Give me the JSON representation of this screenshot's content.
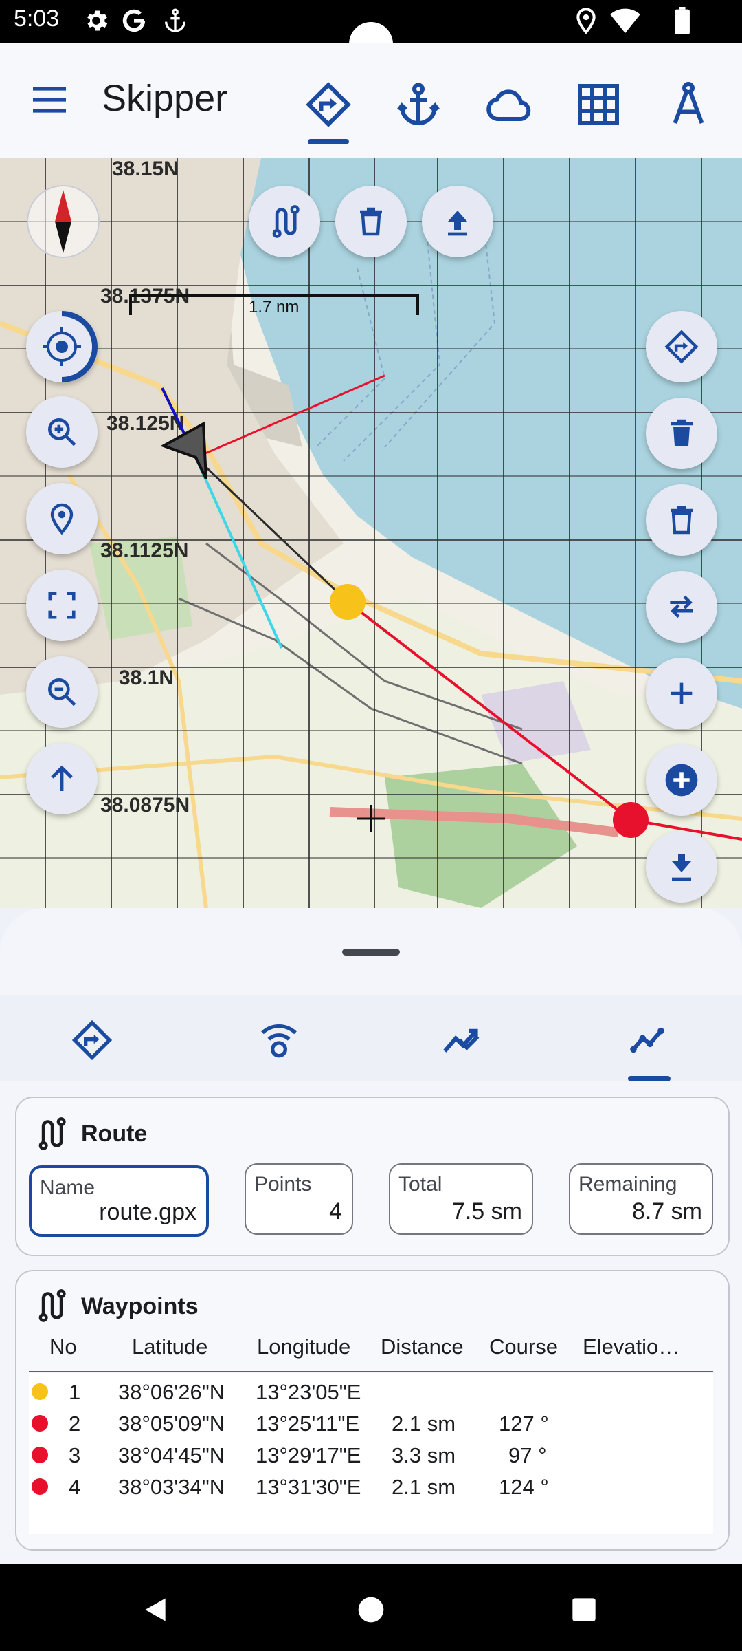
{
  "status_bar": {
    "time": "5:03",
    "icons": [
      "settings-icon",
      "google-icon",
      "anchor-icon",
      "location-icon",
      "wifi-icon",
      "battery-icon"
    ]
  },
  "app": {
    "title": "Skipper",
    "tabs": [
      {
        "icon": "route-icon",
        "active": true
      },
      {
        "icon": "anchor-icon",
        "active": false
      },
      {
        "icon": "cloud-icon",
        "active": false
      },
      {
        "icon": "grid-icon",
        "active": false
      },
      {
        "icon": "compass-divider-icon",
        "active": false
      }
    ]
  },
  "map": {
    "lat_labels": [
      "38.15N",
      "38.1375N",
      "38.125N",
      "38.1125N",
      "38.1N",
      "38.0875N"
    ],
    "scale_label": "1.7 nm",
    "top_buttons": [
      "route-icon",
      "delete-icon",
      "upload-icon"
    ],
    "left_buttons": [
      "locate-icon",
      "zoom-in-icon",
      "pin-icon",
      "fit-screen-icon",
      "zoom-out-icon",
      "north-up-icon"
    ],
    "right_buttons": [
      "route-icon",
      "delete-filled-icon",
      "delete-icon",
      "swap-icon",
      "add-icon",
      "add-circle-icon",
      "download-icon"
    ]
  },
  "bottom_tabs": [
    {
      "icon": "route-icon",
      "active": false
    },
    {
      "icon": "signal-icon",
      "active": false
    },
    {
      "icon": "trend-icon",
      "active": false
    },
    {
      "icon": "chart-line-icon",
      "active": true
    }
  ],
  "route": {
    "title": "Route",
    "name_label": "Name",
    "name_value": "route.gpx",
    "points_label": "Points",
    "points_value": "4",
    "total_label": "Total",
    "total_value": "7.5 sm",
    "remaining_label": "Remaining",
    "remaining_value": "8.7 sm"
  },
  "waypoints": {
    "title": "Waypoints",
    "columns": [
      "No",
      "Latitude",
      "Longitude",
      "Distance",
      "Course",
      "Elevatio…"
    ],
    "rows": [
      {
        "no": "1",
        "lat": "38°06'26\"N",
        "lon": "13°23'05\"E",
        "dist": "",
        "course": "",
        "color": "#f7c21a"
      },
      {
        "no": "2",
        "lat": "38°05'09\"N",
        "lon": "13°25'11\"E",
        "dist": "2.1 sm",
        "course": "127 °",
        "color": "#e8112d"
      },
      {
        "no": "3",
        "lat": "38°04'45\"N",
        "lon": "13°29'17\"E",
        "dist": "3.3 sm",
        "course": "97 °",
        "color": "#e8112d"
      },
      {
        "no": "4",
        "lat": "38°03'34\"N",
        "lon": "13°31'30\"E",
        "dist": "2.1 sm",
        "course": "124 °",
        "color": "#e8112d"
      }
    ]
  },
  "colors": {
    "accent": "#1a4ba0",
    "sea": "#aad3df",
    "land": "#f2efe6"
  }
}
